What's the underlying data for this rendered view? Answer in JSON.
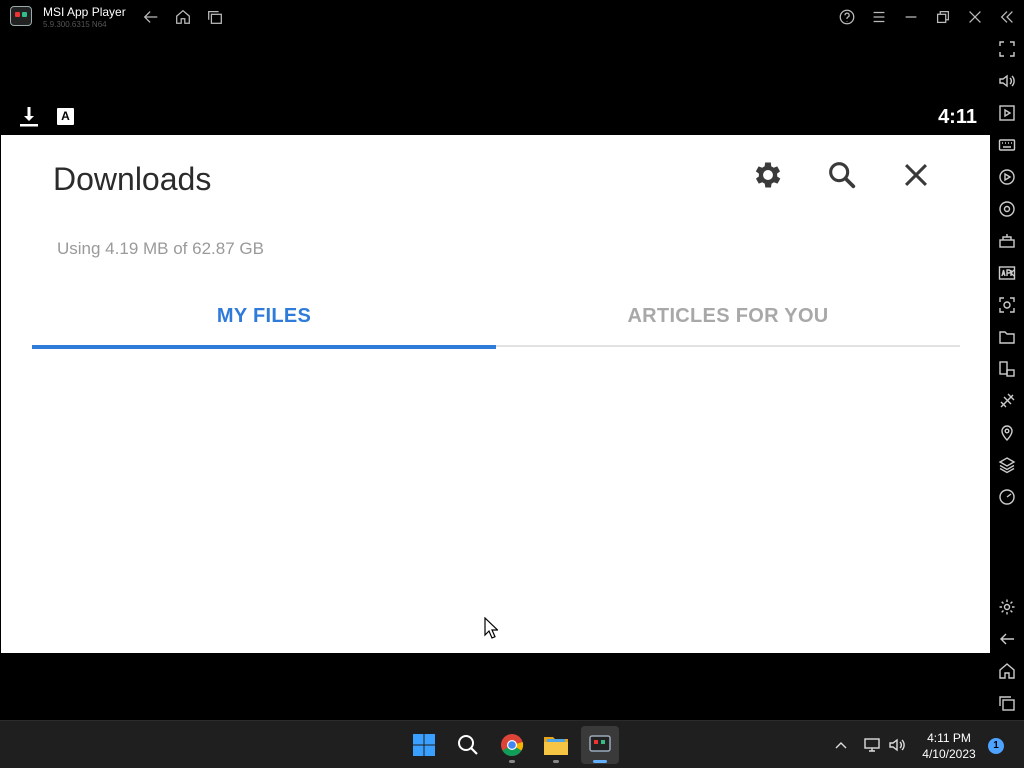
{
  "window": {
    "title": "MSI App Player",
    "version": "5.9.300.6315  N64"
  },
  "status_bar": {
    "time": "4:11",
    "keyboard_indicator": "A"
  },
  "downloads": {
    "title": "Downloads",
    "storage_text": "Using 4.19 MB of 62.87 GB",
    "tabs": [
      {
        "label": "MY FILES",
        "active": true
      },
      {
        "label": "ARTICLES FOR YOU",
        "active": false
      }
    ],
    "icons": [
      "settings-icon",
      "search-icon",
      "close-icon"
    ]
  },
  "sidebar": {
    "icons": [
      "fullscreen-icon",
      "volume-icon",
      "media-icon",
      "keyboard-icon",
      "macro-icon",
      "sync-icon",
      "multi-instance-icon",
      "apk-icon",
      "screenshot-icon",
      "folder-icon",
      "rotate-icon",
      "eco-icon",
      "location-icon",
      "layers-icon",
      "performance-icon",
      "settings-icon",
      "back-icon",
      "home-icon",
      "recents-icon"
    ]
  },
  "taskbar": {
    "time": "4:11 PM",
    "date": "4/10/2023",
    "notification_count": "1",
    "apps": [
      "start-icon",
      "search-icon",
      "chrome-icon",
      "file-explorer-icon",
      "msi-app-player-icon"
    ]
  },
  "colors": {
    "accent": "#2f7bd9",
    "inactive_tab": "#a8a8a8",
    "title_text": "#2b2b2b",
    "storage_text": "#9a9a9a"
  }
}
